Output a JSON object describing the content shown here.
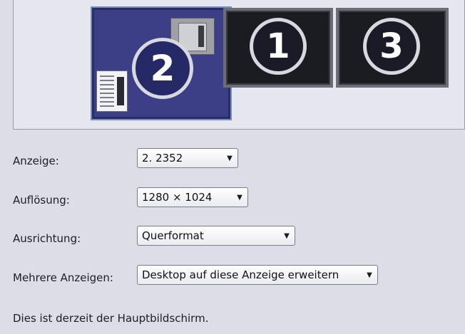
{
  "monitors": [
    {
      "id": "2",
      "label": "2",
      "selected": true
    },
    {
      "id": "1",
      "label": "1",
      "selected": false
    },
    {
      "id": "3",
      "label": "3",
      "selected": false
    }
  ],
  "settings": {
    "display": {
      "label": "Anzeige:",
      "value": "2. 2352"
    },
    "resolution": {
      "label": "Auflösung:",
      "value": "1280 × 1024"
    },
    "orientation": {
      "label": "Ausrichtung:",
      "value": "Querformat"
    },
    "multiple_displays": {
      "label": "Mehrere Anzeigen:",
      "value": "Desktop auf diese Anzeige erweitern"
    }
  },
  "status": "Dies ist derzeit der Hauptbildschirm.",
  "colors": {
    "selected_monitor": "#3c3f85",
    "selected_border": "#6f8ec9",
    "inactive_monitor": "#1b1c22",
    "background": "#dcdde6"
  },
  "icons": {
    "dropdown": "chevron-down-icon"
  }
}
